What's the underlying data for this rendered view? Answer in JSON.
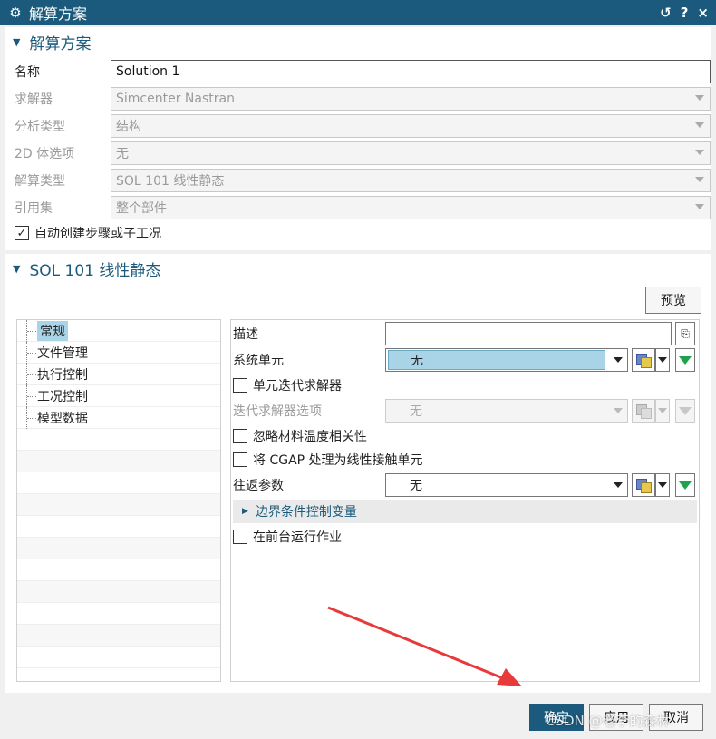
{
  "window": {
    "title": "解算方案",
    "controls": {
      "reset": "↺",
      "help": "?",
      "close": "×"
    }
  },
  "section1": {
    "title": "解算方案",
    "fields": [
      {
        "label": "名称",
        "value": "Solution 1",
        "enabled": true
      },
      {
        "label": "求解器",
        "value": "Simcenter Nastran",
        "enabled": false
      },
      {
        "label": "分析类型",
        "value": "结构",
        "enabled": false
      },
      {
        "label": "2D 体选项",
        "value": "无",
        "enabled": false
      },
      {
        "label": "解算类型",
        "value": "SOL 101 线性静态",
        "enabled": false
      },
      {
        "label": "引用集",
        "value": "整个部件",
        "enabled": false
      }
    ],
    "auto_create": {
      "label": "自动创建步骤或子工况",
      "checked": true
    }
  },
  "section2": {
    "title": "SOL 101 线性静态",
    "preview_label": "预览",
    "tree": [
      "常规",
      "文件管理",
      "执行控制",
      "工况控制",
      "模型数据"
    ],
    "tree_selected": "常规",
    "props": {
      "description_label": "描述",
      "description_value": "",
      "system_unit_label": "系统单元",
      "system_unit_value": "无",
      "element_iter_label": "单元迭代求解器",
      "iter_options_label": "迭代求解器选项",
      "iter_options_value": "无",
      "ignore_temp_label": "忽略材料温度相关性",
      "cgap_label": "将 CGAP 处理为线性接触单元",
      "roundtrip_label": "往返参数",
      "roundtrip_value": "无",
      "boundary_label": "边界条件控制变量",
      "foreground_label": "在前台运行作业"
    }
  },
  "footer": {
    "ok": "确定",
    "apply": "应用",
    "cancel": "取消"
  },
  "watermark": "CSDN @老李的森林",
  "colors": {
    "accent": "#1b5a7c",
    "highlight": "#a9d3e6",
    "arrow": "#e83a3a",
    "green": "#1ea34a"
  },
  "icons": [
    "gear-icon",
    "reset-icon",
    "help-icon",
    "close-icon",
    "add-file-icon",
    "function-icon",
    "green-triangle-icon"
  ]
}
